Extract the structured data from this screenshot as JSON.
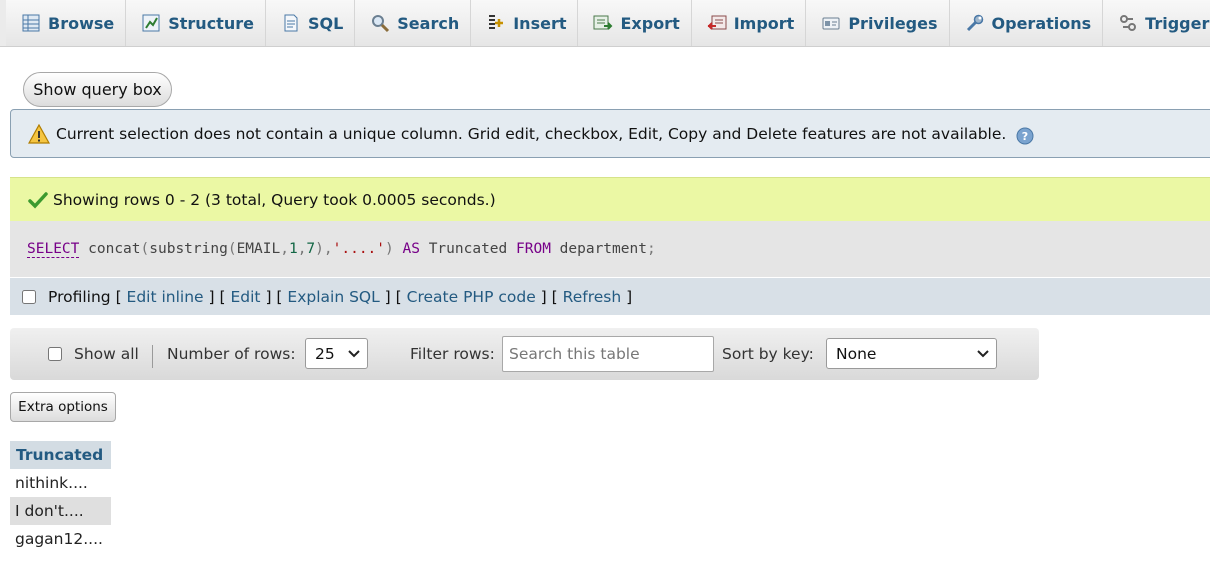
{
  "tabs": [
    {
      "label": "Browse",
      "icon": "browse-icon"
    },
    {
      "label": "Structure",
      "icon": "structure-icon"
    },
    {
      "label": "SQL",
      "icon": "sql-icon"
    },
    {
      "label": "Search",
      "icon": "search-icon"
    },
    {
      "label": "Insert",
      "icon": "insert-icon"
    },
    {
      "label": "Export",
      "icon": "export-icon"
    },
    {
      "label": "Import",
      "icon": "import-icon"
    },
    {
      "label": "Privileges",
      "icon": "privileges-icon"
    },
    {
      "label": "Operations",
      "icon": "operations-icon"
    },
    {
      "label": "Triggers",
      "icon": "triggers-icon"
    }
  ],
  "query_box_button": "Show query box",
  "notice": {
    "text": "Current selection does not contain a unique column. Grid edit, checkbox, Edit, Copy and Delete features are not available.",
    "icon": "warning-icon",
    "help_icon": "help-icon"
  },
  "success": {
    "text": "Showing rows 0 - 2 (3 total, Query took 0.0005 seconds.)",
    "icon": "check-icon"
  },
  "sql": {
    "select": "SELECT",
    "fn1": "concat",
    "fn2": "substring",
    "col": "EMAIL",
    "n1": "1",
    "n2": "7",
    "str": "'....'",
    "as": "AS",
    "alias": "Truncated",
    "from": "FROM",
    "table": "department"
  },
  "links": {
    "profiling": "Profiling",
    "edit_inline": "Edit inline",
    "edit": "Edit",
    "explain": "Explain SQL",
    "create_php": "Create PHP code",
    "refresh": "Refresh"
  },
  "nav": {
    "show_all": "Show all",
    "number_of_rows_label": "Number of rows:",
    "number_of_rows_value": "25",
    "filter_rows_label": "Filter rows:",
    "filter_placeholder": "Search this table",
    "sort_by_label": "Sort by key:",
    "sort_by_value": "None"
  },
  "extra_options": "Extra options",
  "results": {
    "columns": [
      "Truncated"
    ],
    "rows": [
      [
        "nithink...."
      ],
      [
        "I don't...."
      ],
      [
        "gagan12...."
      ]
    ]
  },
  "colors": {
    "link": "#235a81",
    "success_bg": "#ebf8a4",
    "notice_bg": "#e4ebf1",
    "sql_keyword": "#770088"
  }
}
